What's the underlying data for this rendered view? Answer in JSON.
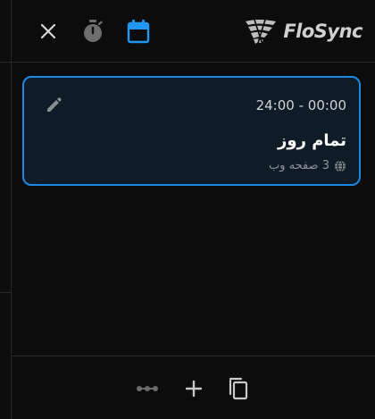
{
  "header": {
    "logo_text": "FloSync",
    "buttons": {
      "close": "close-icon",
      "timer": "timer-icon",
      "calendar": "calendar-icon"
    }
  },
  "card": {
    "time_range": "24:00 - 00:00",
    "title": "تمام روز",
    "meta": "3 صفحه وب",
    "edit_icon": "pencil-icon",
    "meta_icon": "globe-icon"
  },
  "footer": {
    "buttons": [
      "link-icon",
      "add-icon",
      "copy-icon"
    ]
  },
  "colors": {
    "background": "#0c0c0c",
    "accent": "#1e88e5",
    "card_background": "#0f1c27",
    "icon_default": "#c8c8c8",
    "icon_muted": "#6b6b6b"
  }
}
